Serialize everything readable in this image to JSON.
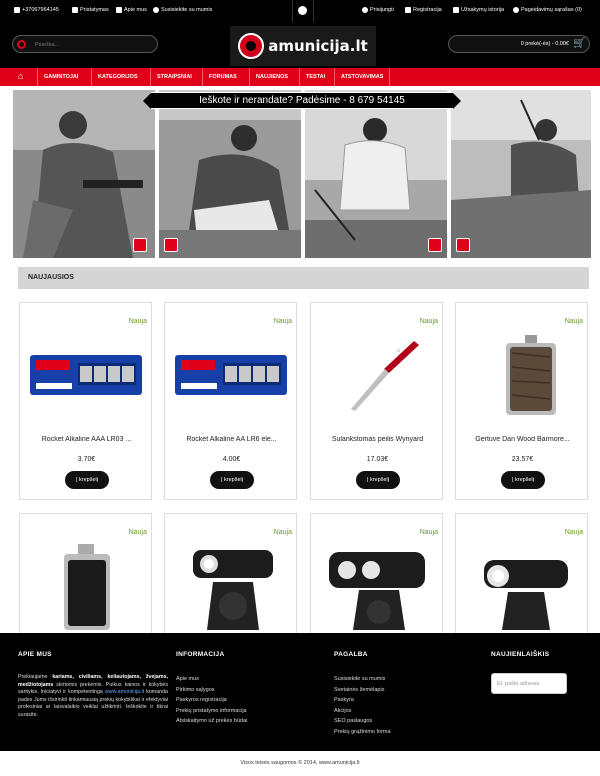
{
  "topbar": {
    "phone": "+37067964145",
    "delivery": "Pristatymas",
    "about": "Apie mus",
    "contact": "Susisiekite su mumis",
    "login": "Prisijungti",
    "register": "Registracija",
    "orders": "Užsakymų istorija",
    "wishlist": "Pageidavimų sąrašas (0)"
  },
  "header": {
    "search_placeholder": "Paieška...",
    "logo_text": "amunicija.lt",
    "cart_text": "0 prekė(-ės) - 0.00€"
  },
  "nav": {
    "items": [
      "GAMINTOJAI",
      "KATEGORIJOS",
      "STRAIPSNIAI",
      "FORUMAS",
      "NAUJIENOS",
      "TESTAI",
      "ATSTOVAVIMAS"
    ]
  },
  "hero": {
    "banner_text": "Ieškote ir nerandate? Padėsime - 8 679 54145"
  },
  "section": {
    "title": "NAUJAUSIOS"
  },
  "products": [
    {
      "badge": "Nauja",
      "name": "Rocket Alkaline AAA LR03 ...",
      "price": "3.70€",
      "button": "Į krepšelį",
      "image": "battery-pack-blue"
    },
    {
      "badge": "Nauja",
      "name": "Rocket Alkaline AA LR6 ele...",
      "price": "4.00€",
      "button": "Į krepšelį",
      "image": "battery-pack-blue"
    },
    {
      "badge": "Nauja",
      "name": "Sulankstomas peilis Wynyard",
      "price": "17.03€",
      "button": "Į krepšelį",
      "image": "folding-knife-red"
    },
    {
      "badge": "Nauja",
      "name": "Gertuvė Dan Wood Barmore...",
      "price": "23.57€",
      "button": "Į krepšelį",
      "image": "hip-flask-wood"
    },
    {
      "badge": "Nauja",
      "image": "hip-flask-black"
    },
    {
      "badge": "Nauja",
      "image": "bike-light-black"
    },
    {
      "badge": "Nauja",
      "image": "bike-light-double"
    },
    {
      "badge": "Nauja",
      "image": "bike-light-black"
    }
  ],
  "footer": {
    "about_title": "APIE MUS",
    "about_text_1": "Prekiaujame ",
    "about_bold": "kariams, civiliams, keliautojams, žvejams, medžiotojams",
    "about_text_2": " skirtomis prekėmis. Puikus kainos ir kokybės santykis. Iniciatyvi ir kompetentinga ",
    "about_link": "www.amunicija.lt",
    "about_text_3": " komanda pades Jums išsirinkti tinkamiausią prekių kokybiškai ir efektyviai profesiniai ar laisvalaikio veiklai užtikrinti. Ieškokite ir tikrai surasite.",
    "info_title": "INFORMACIJA",
    "info_items": [
      "Apie mus",
      "Pirkimo sąlygos",
      "Paskyros registracija",
      "Prekių pristatymo informacija",
      "Atsiskaitymo už prekes būdai"
    ],
    "help_title": "PAGALBA",
    "help_items": [
      "Susisiekite su mumis",
      "Svetainės žemėlapis",
      "Paskyra",
      "Akcijos",
      "SEO paslaugos",
      "Prekių grąžinimo forma"
    ],
    "news_title": "NAUJIENLAIŠKIS",
    "news_placeholder": "El. pašto adresas"
  },
  "copyright": "Visos teisės saugomos © 2014, www.amunicija.lt"
}
